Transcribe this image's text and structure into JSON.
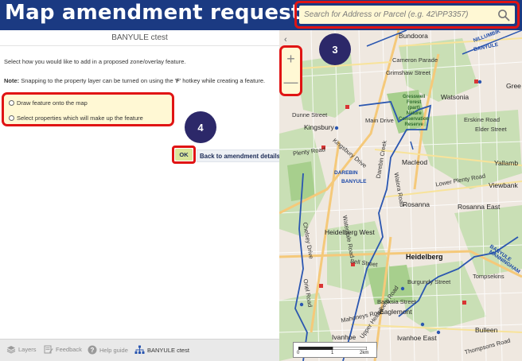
{
  "header": {
    "title": "Map amendment requests",
    "search_placeholder": "Search for Address or Parcel (e.g. 42\\PP3357)"
  },
  "panel": {
    "title": "BANYULE ctest",
    "instruction": "Select how you would like to add in a proposed zone/overlay feature.",
    "note_label": "Note:",
    "note_pre": " Snapping to the property layer can be turned on using the '",
    "note_key": "F",
    "note_post": "' hotkey while creating a feature.",
    "options": [
      {
        "label": "Draw feature onto the map"
      },
      {
        "label": "Select properties which will make up the feature"
      }
    ],
    "ok_label": "OK",
    "back_label": "Back to amendment details"
  },
  "annotations": {
    "badge_3": "3",
    "badge_4": "4"
  },
  "bottom_tabs": [
    {
      "label": "Layers",
      "icon": "layers-icon"
    },
    {
      "label": "Feedback",
      "icon": "feedback-icon"
    },
    {
      "label": "Help guide",
      "icon": "help-icon"
    },
    {
      "label": "BANYULE ctest",
      "icon": "sitemap-icon"
    }
  ],
  "map": {
    "collapse": "‹",
    "zoom_in": "+",
    "zoom_out": "—",
    "scale": {
      "l0": "0",
      "l1": "1",
      "l2": "2km"
    },
    "labels": {
      "bundoora": "Bundoora",
      "nillumbik": "NILLUMBIK",
      "banyule_ne": "BANYULE",
      "cameron": "Cameron Parade",
      "grimshaw": "Grimshaw Street",
      "watsonia": "Watsonia",
      "gree": "Gree",
      "greensborough": "Greensborough",
      "dunne": "Dunne Street",
      "main": "Main Drive",
      "erskine": "Erskine Road",
      "elder": "Elder Street",
      "kingsbury": "Kingsbury",
      "forest": "Gresswell\nForest\n(part)\nNature\nConservation\nReserve",
      "plenty_road": "Plenty Road",
      "kingsbury_drive": "Kingsbury Drive",
      "macleod": "Macleod",
      "yallambie": "Yallamb",
      "lower_plenty": "Lower Plenty Road",
      "viewbank": "Viewbank",
      "darebin": "DAREBIN",
      "banyule_w": "BANYULE",
      "rosanna": "Rosanna",
      "rosanna_east": "Rosanna East",
      "heidelberg_west": "Heidelberg West",
      "heidelberg": "Heidelberg",
      "banyule_e": "BANYULE",
      "manningham": "MANNINGHAM",
      "bell": "Bell Street",
      "upper_heidelberg": "Upper Heidelberg Road",
      "burgundy": "Burgundy Street",
      "banksia": "Banksia Street",
      "eaglemont": "Eaglemont",
      "mahoneys": "Mahoneys Road",
      "ivanhoe": "Ivanhoe",
      "ivanhoe_east": "Ivanhoe East",
      "bulleen": "Bulleen",
      "thompsons": "Thompsons Road",
      "waterdale": "Waterdale Road",
      "oriel": "Oriel Road",
      "chelsey": "Chelsey Drive",
      "waiora": "Waiora Road",
      "darebin_creek": "Darebin Creek",
      "tompkins": "Tompsekins"
    }
  }
}
